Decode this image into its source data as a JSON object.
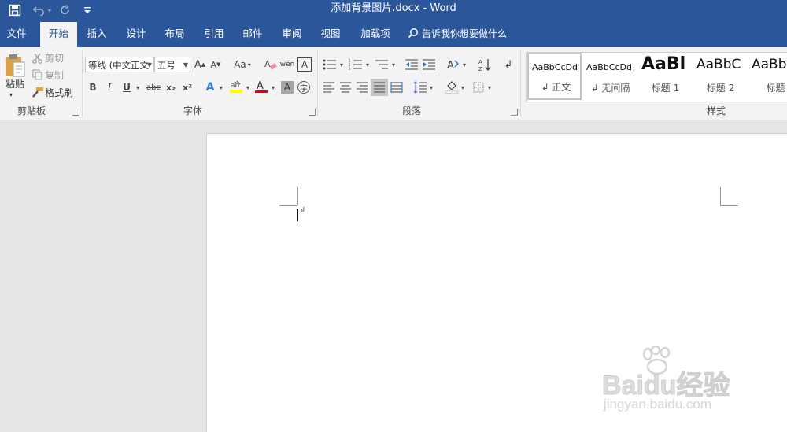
{
  "window": {
    "title": "添加背景图片.docx - Word"
  },
  "quick_access": {
    "save_icon": "save-icon",
    "undo_icon": "undo-icon",
    "redo_icon": "redo-icon",
    "customize_icon": "customize-icon"
  },
  "tabs": [
    {
      "label": "文件"
    },
    {
      "label": "开始"
    },
    {
      "label": "插入"
    },
    {
      "label": "设计"
    },
    {
      "label": "布局"
    },
    {
      "label": "引用"
    },
    {
      "label": "邮件"
    },
    {
      "label": "审阅"
    },
    {
      "label": "视图"
    },
    {
      "label": "加载项"
    }
  ],
  "tell_me": {
    "text": "告诉我你想要做什么"
  },
  "clipboard": {
    "paste": "粘贴",
    "cut": "剪切",
    "copy": "复制",
    "format_painter": "格式刷",
    "group_label": "剪贴板"
  },
  "font": {
    "font_name": "等线 (中文正文",
    "font_size": "五号",
    "change_case": "Aa",
    "bold": "B",
    "italic": "I",
    "underline": "U",
    "strikethrough": "abc",
    "subscript": "x₂",
    "superscript": "x²",
    "group_label": "字体"
  },
  "paragraph": {
    "group_label": "段落"
  },
  "styles": {
    "items": [
      {
        "preview": "AaBbCcDd",
        "name": "↲ 正文"
      },
      {
        "preview": "AaBbCcDd",
        "name": "↲ 无间隔"
      },
      {
        "preview": "AaBl",
        "name": "标题 1"
      },
      {
        "preview": "AaBbC",
        "name": "标题 2"
      },
      {
        "preview": "AaBb",
        "name": "标题"
      }
    ],
    "group_label": "样式"
  },
  "watermark": {
    "logo": "Baidu经验",
    "url": "jingyan.baidu.com"
  },
  "colors": {
    "accent": "#2b579a",
    "highlight": "#ffff00",
    "font_color": "#e0001b"
  }
}
